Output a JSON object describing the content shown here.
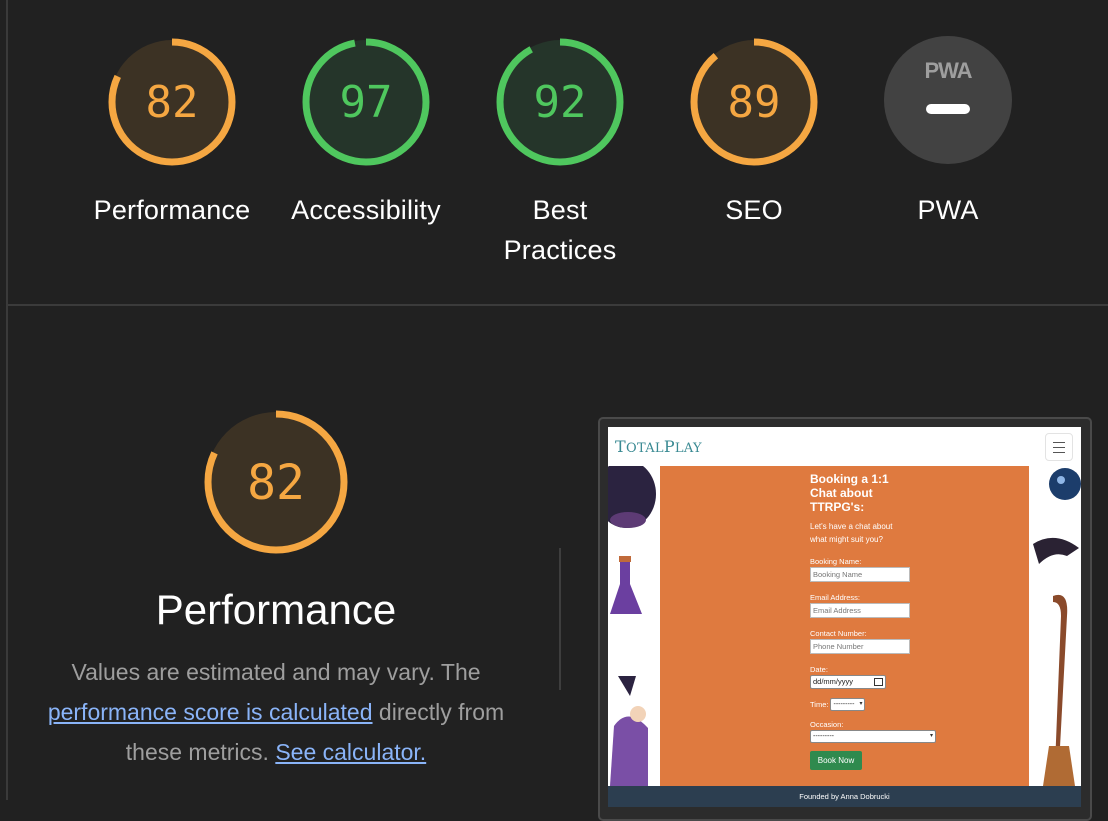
{
  "categories": [
    {
      "id": "performance",
      "score": "82",
      "label": "Performance",
      "color": "#f5a742",
      "track": "#3c3224"
    },
    {
      "id": "accessibility",
      "score": "97",
      "label": "Accessibility",
      "color": "#4fc75e",
      "track": "#25352a"
    },
    {
      "id": "best-practices",
      "score": "92",
      "label_line1": "Best",
      "label_line2": "Practices",
      "color": "#4fc75e",
      "track": "#25352a"
    },
    {
      "id": "seo",
      "score": "89",
      "label": "SEO",
      "color": "#f5a742",
      "track": "#3c3224"
    },
    {
      "id": "pwa",
      "logo": "PWA",
      "label": "PWA"
    }
  ],
  "detail": {
    "score": "82",
    "title": "Performance",
    "desc_text1": "Values are estimated and may vary. The ",
    "desc_link1": "performance score is calculated",
    "desc_text2": " directly from these metrics. ",
    "desc_link2": "See calculator."
  },
  "screenshot": {
    "brand_first": "T",
    "brand_rest1": "OTAL",
    "brand_P": "P",
    "brand_rest2": "LAY",
    "form_title_l1": "Booking a 1:1",
    "form_title_l2": "Chat about",
    "form_title_l3": "TTRPG's:",
    "form_sub_l1": "Let's have a chat about",
    "form_sub_l2": "what might suit you?",
    "label_name": "Booking Name:",
    "placeholder_name": "Booking Name",
    "label_email": "Email Address:",
    "placeholder_email": "Email Address",
    "label_contact": "Contact Number:",
    "placeholder_contact": "Phone Number",
    "label_date": "Date:",
    "date_value": "dd/mm/yyyy",
    "label_time": "Time:",
    "time_value": "---------",
    "label_occasion": "Occasion:",
    "occasion_value": "---------",
    "button_label": "Book Now",
    "footer_text": "Founded by Anna Dobrucki"
  },
  "colors": {
    "average": "#f5a742",
    "pass": "#4fc75e",
    "link": "#8ab4f8",
    "bg": "#212121"
  },
  "icons": {
    "pwa": "pwa-badge-icon",
    "menu": "hamburger-menu-icon"
  }
}
